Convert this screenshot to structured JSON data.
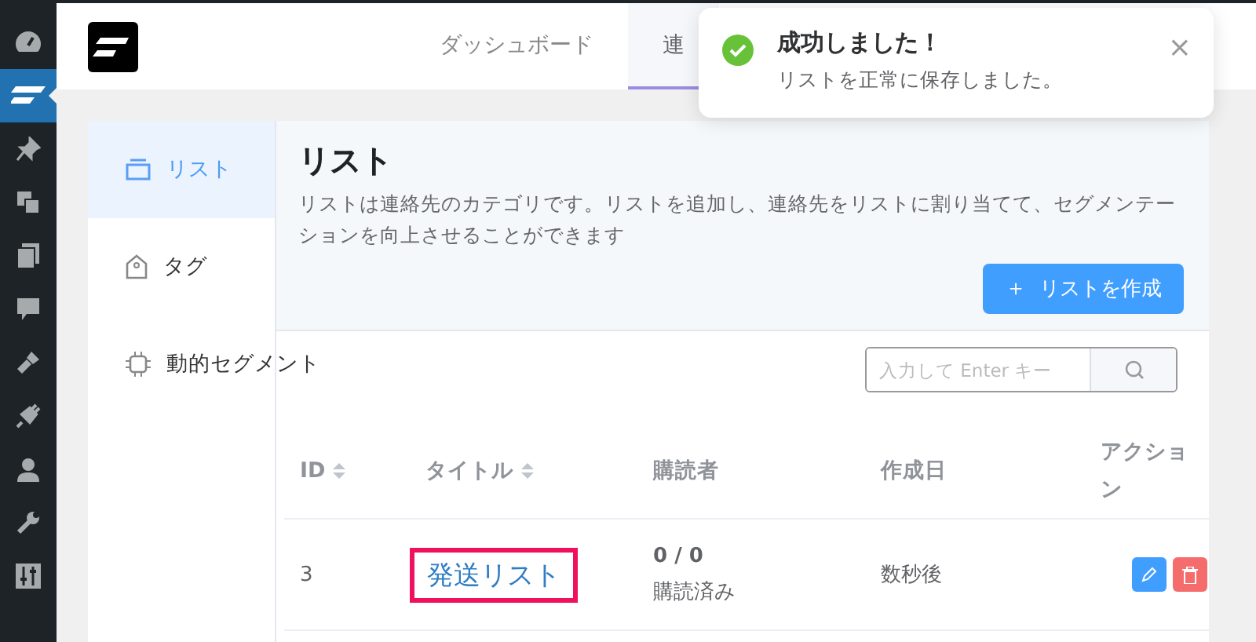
{
  "admin_menu": [
    {
      "selected": false
    },
    {
      "selected": true
    },
    {
      "selected": false
    },
    {
      "selected": false
    },
    {
      "selected": false
    },
    {
      "selected": false
    },
    {
      "selected": false
    },
    {
      "selected": false
    },
    {
      "selected": false
    },
    {
      "selected": false
    },
    {
      "selected": false
    }
  ],
  "tabs": [
    {
      "label": "ダッシュボード",
      "selected": false
    },
    {
      "label": "連",
      "selected": true
    }
  ],
  "toast": {
    "title": "成功しました！",
    "message": "リストを正常に保存しました。",
    "close": "×"
  },
  "sidebar": {
    "items": [
      {
        "label": "リスト",
        "selected": true
      },
      {
        "label": "タグ",
        "selected": false
      },
      {
        "label": "動的セグメント",
        "selected": false
      }
    ]
  },
  "header": {
    "title": "リスト",
    "description": "リストは連絡先のカテゴリです。リストを追加し、連絡先をリストに割り当てて、セグメンテーションを向上させることができます",
    "create_button": {
      "icon": "＋",
      "label": "リストを作成"
    }
  },
  "search": {
    "placeholder": "入力して Enter キー"
  },
  "table": {
    "columns": [
      {
        "label": "ID"
      },
      {
        "label": "タイトル"
      },
      {
        "label": "購読者"
      },
      {
        "label": "作成日"
      },
      {
        "label": "アクション"
      }
    ],
    "rows": [
      {
        "id": "3",
        "title": "発送リスト",
        "highlighted": true,
        "subscribers": "0 / 0",
        "subscribed_label": "購読済み",
        "created": "数秒後"
      }
    ]
  }
}
